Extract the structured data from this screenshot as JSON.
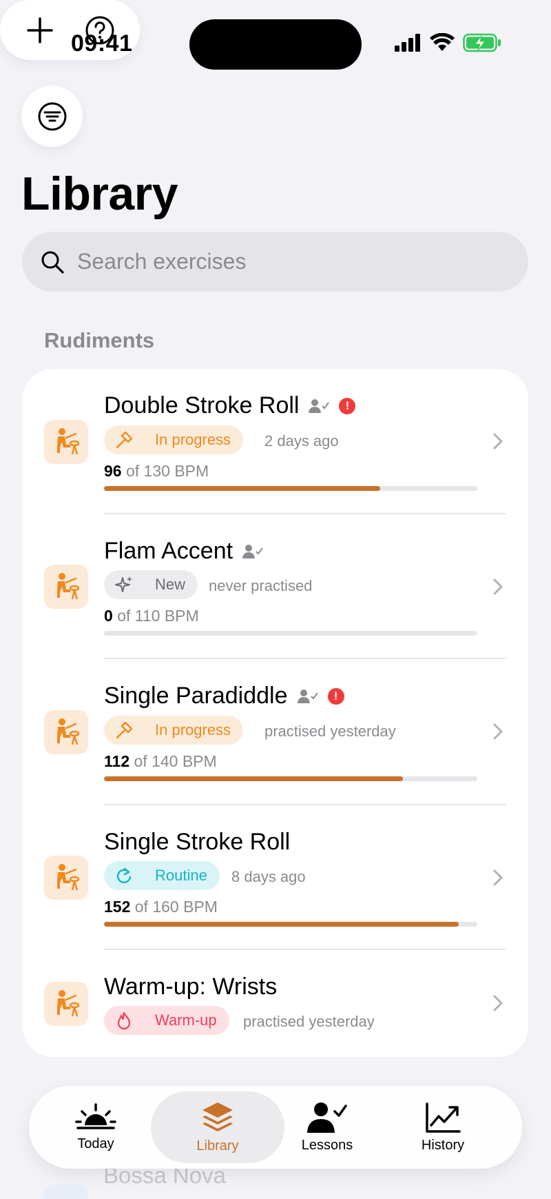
{
  "status_bar": {
    "time": "09:41"
  },
  "header": {
    "title": "Library"
  },
  "search": {
    "placeholder": "Search exercises"
  },
  "section": {
    "title": "Rudiments"
  },
  "exercises": [
    {
      "title": "Double Stroke Roll",
      "badge": "In progress",
      "badge_type": "in-progress",
      "last_practised": "2 days ago",
      "bpm_current": "96",
      "bpm_target": "of 130 BPM",
      "progress": 0.74,
      "has_alert": true,
      "alert_symbol": "!"
    },
    {
      "title": "Flam Accent",
      "badge": "New",
      "badge_type": "new",
      "last_practised": "never practised",
      "bpm_current": "0",
      "bpm_target": "of 110 BPM",
      "progress": 0.0,
      "has_alert": false
    },
    {
      "title": "Single Paradiddle",
      "badge": "In progress",
      "badge_type": "in-progress",
      "last_practised": "practised yesterday",
      "bpm_current": "112",
      "bpm_target": "of 140 BPM",
      "progress": 0.8,
      "has_alert": true,
      "alert_symbol": "!"
    },
    {
      "title": "Single Stroke Roll",
      "badge": "Routine",
      "badge_type": "routine",
      "last_practised": "8 days ago",
      "bpm_current": "152",
      "bpm_target": "of 160 BPM",
      "progress": 0.95,
      "has_alert": false
    },
    {
      "title": "Warm-up: Wrists",
      "badge": "Warm-up",
      "badge_type": "warm-up",
      "last_practised": "practised yesterday"
    }
  ],
  "next_section_preview": {
    "title": "Bossa Nova"
  },
  "tabbar": {
    "tabs": [
      {
        "label": "Today",
        "icon": "sunrise-icon",
        "active": false
      },
      {
        "label": "Library",
        "icon": "stack-icon",
        "active": true
      },
      {
        "label": "Lessons",
        "icon": "person-check-icon",
        "active": false
      },
      {
        "label": "History",
        "icon": "chart-line-icon",
        "active": false
      }
    ]
  },
  "colors": {
    "accent": "#c8712a",
    "background": "#f2f2f7",
    "alert": "#f03a3a",
    "in_progress": "#f08a1c",
    "routine": "#14b6c4",
    "warm_up": "#ef3e5c"
  }
}
